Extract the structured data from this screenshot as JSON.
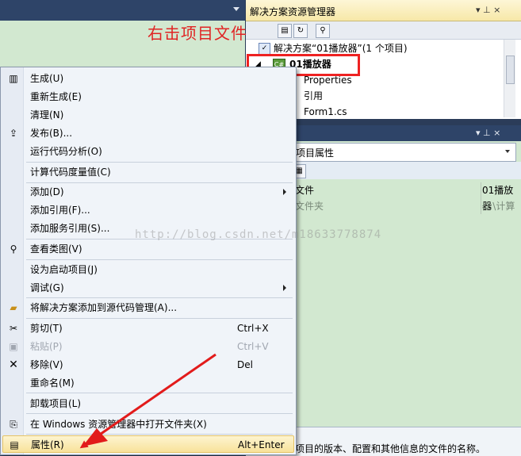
{
  "annotation": {
    "text": "右击项目文件"
  },
  "watermark": "http://blog.csdn.net/m18633778874",
  "solution_explorer": {
    "title": "解决方案资源管理器",
    "header_icons": "▾ ⊥ ×",
    "solution_row": "解决方案“01播放器”(1 个项目)",
    "project": "01播放器",
    "children": [
      "Properties",
      "引用",
      "Form1.cs"
    ]
  },
  "properties": {
    "header_icons": "▾ ⊥ ×",
    "combo": "项目属性",
    "rows": [
      {
        "name": "文件",
        "value": "01播放器"
      },
      {
        "name": "文件夹",
        "value": "D:\\计算"
      }
    ],
    "description": "项目的版本、配置和其他信息的文件的名称。"
  },
  "context_menu": {
    "items": [
      {
        "label": "生成(U)",
        "icon": "build-icon"
      },
      {
        "label": "重新生成(E)"
      },
      {
        "label": "清理(N)"
      },
      {
        "label": "发布(B)...",
        "icon": "publish-icon"
      },
      {
        "label": "运行代码分析(O)"
      },
      {
        "label": "计算代码度量值(C)"
      },
      {
        "label": "添加(D)",
        "submenu": true
      },
      {
        "label": "添加引用(F)..."
      },
      {
        "label": "添加服务引用(S)..."
      },
      {
        "label": "查看类图(V)",
        "icon": "class-diagram-icon"
      },
      {
        "label": "设为启动项目(J)"
      },
      {
        "label": "调试(G)",
        "submenu": true
      },
      {
        "label": "将解决方案添加到源代码管理(A)...",
        "icon": "source-control-icon"
      },
      {
        "label": "剪切(T)",
        "shortcut": "Ctrl+X",
        "icon": "scissors-icon"
      },
      {
        "label": "粘贴(P)",
        "shortcut": "Ctrl+V",
        "icon": "paste-icon",
        "disabled": true
      },
      {
        "label": "移除(V)",
        "shortcut": "Del",
        "icon": "remove-icon"
      },
      {
        "label": "重命名(M)"
      },
      {
        "label": "卸载项目(L)"
      },
      {
        "label": "在 Windows 资源管理器中打开文件夹(X)",
        "icon": "open-folder-icon"
      },
      {
        "label": "属性(R)",
        "shortcut": "Alt+Enter",
        "icon": "properties-icon",
        "highlighted": true
      }
    ]
  }
}
